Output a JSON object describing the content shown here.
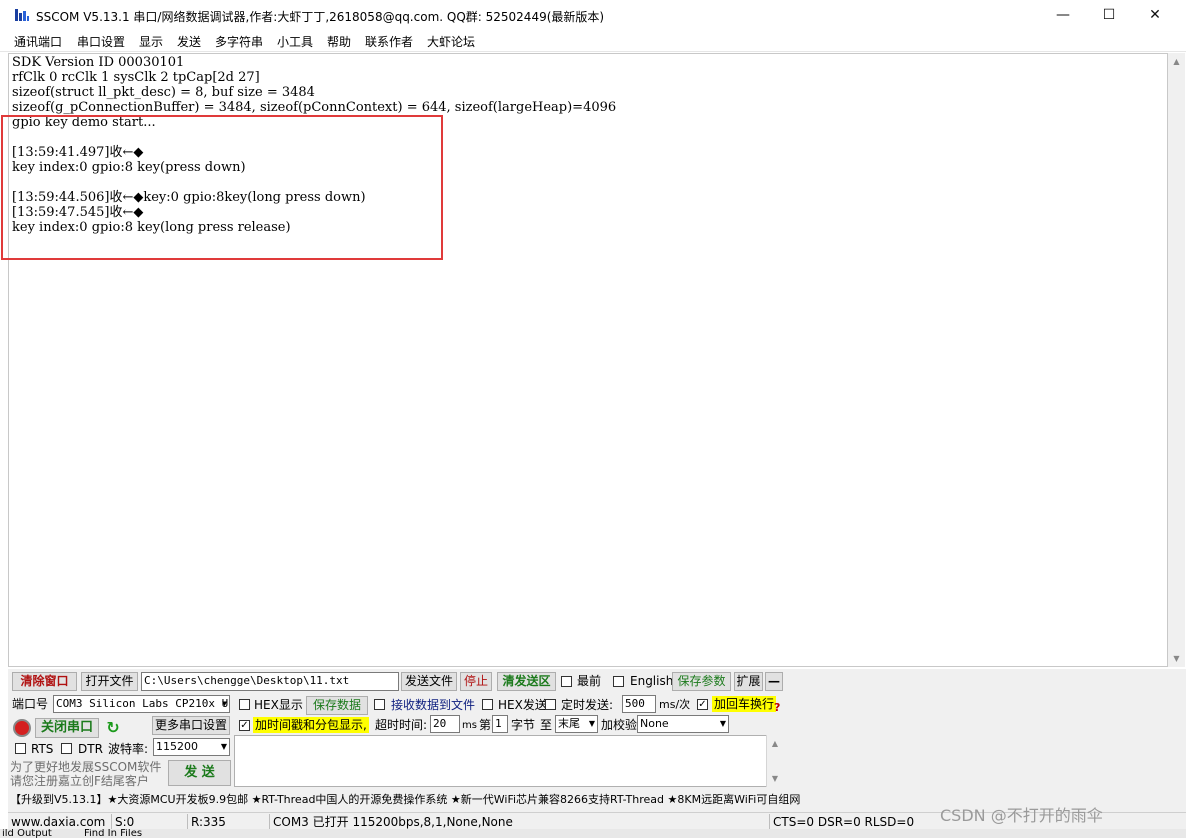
{
  "window": {
    "title": "SSCOM V5.13.1 串口/网络数据调试器,作者:大虾丁丁,2618058@qq.com. QQ群: 52502449(最新版本)",
    "minimize": "—",
    "maximize": "☐",
    "close": "✕"
  },
  "menu": [
    "通讯端口",
    "串口设置",
    "显示",
    "发送",
    "多字符串",
    "小工具",
    "帮助",
    "联系作者",
    "大虾论坛"
  ],
  "terminal": {
    "lines": [
      "SDK Version ID 00030101",
      "rfClk 0 rcClk 1 sysClk 2 tpCap[2d 27]",
      "sizeof(struct ll_pkt_desc) = 8, buf size = 3484",
      "sizeof(g_pConnectionBuffer) = 3484, sizeof(pConnContext) = 644, sizeof(largeHeap)=4096",
      "gpio key demo start...",
      "",
      "[13:59:41.497]收←◆",
      "key index:0 gpio:8 key(press down)",
      "",
      "[13:59:44.506]收←◆key:0 gpio:8key(long press down)",
      "[13:59:47.545]收←◆",
      "key index:0 gpio:8 key(long press release)"
    ]
  },
  "toolbar1": {
    "clear": "清除窗口",
    "open_file": "打开文件",
    "file_path": "C:\\Users\\chengge\\Desktop\\11.txt",
    "send_file": "发送文件",
    "stop": "停止",
    "clear_send": "清发送区",
    "topmost": "最前",
    "english": "English",
    "save_params": "保存参数",
    "expand": "扩展",
    "collapse": "—"
  },
  "port": {
    "label": "端口号",
    "value": "COM3 Silicon Labs CP210x U",
    "close_port": "关闭串口",
    "more_settings": "更多串口设置",
    "rts": "RTS",
    "dtr": "DTR",
    "baud_label": "波特率:",
    "baud": "115200",
    "promo1": "为了更好地发展SSCOM软件",
    "promo2": "请您注册嘉立创F结尾客户",
    "send": "发  送"
  },
  "options": {
    "hex_display": "HEX显示",
    "save_data": "保存数据",
    "recv_to_file": "接收数据到文件",
    "hex_send": "HEX发送",
    "timed_send": "定时发送:",
    "interval": "500",
    "interval_unit": "ms/次",
    "add_crlf": "加回车换行",
    "timestamp": "加时间戳和分包显示,",
    "timeout_label": "超时时间:",
    "timeout": "20",
    "timeout_unit": "ms",
    "nth_label": "第",
    "nth": "1",
    "byte_label": "字节",
    "to_label": "至",
    "end_option": "末尾",
    "checksum_label": "加校验",
    "checksum": "None",
    "help_mark": "?"
  },
  "ticker": "【升级到V5.13.1】★大资源MCU开发板9.9包邮 ★RT-Thread中国人的开源免费操作系统 ★新一代WiFi芯片兼容8266支持RT-Thread ★8KM远距离WiFi可自组网",
  "status": {
    "site": "www.daxia.com",
    "sent": "S:0",
    "received": "R:335",
    "port_state": "COM3 已打开  115200bps,8,1,None,None",
    "lines": "CTS=0 DSR=0 RLSD=0"
  },
  "watermark": "CSDN @不打开的雨伞",
  "background": {
    "output_tab": "ild Output",
    "find_tab": "Find In Files"
  }
}
